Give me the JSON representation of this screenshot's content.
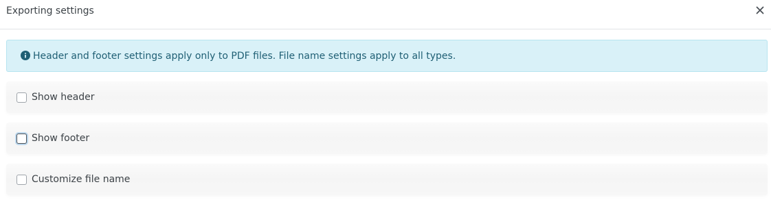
{
  "dialog": {
    "title": "Exporting settings",
    "close_icon": "close-icon"
  },
  "alert": {
    "icon": "info-icon",
    "text": "Header and footer settings apply only to PDF files. File name settings apply to all types.",
    "background_color": "#d9f1f8",
    "text_color": "#1f5f74"
  },
  "options": [
    {
      "label": "Show header",
      "checked": false,
      "focused": false
    },
    {
      "label": "Show footer",
      "checked": false,
      "focused": true
    },
    {
      "label": "Customize file name",
      "checked": false,
      "focused": false
    }
  ]
}
